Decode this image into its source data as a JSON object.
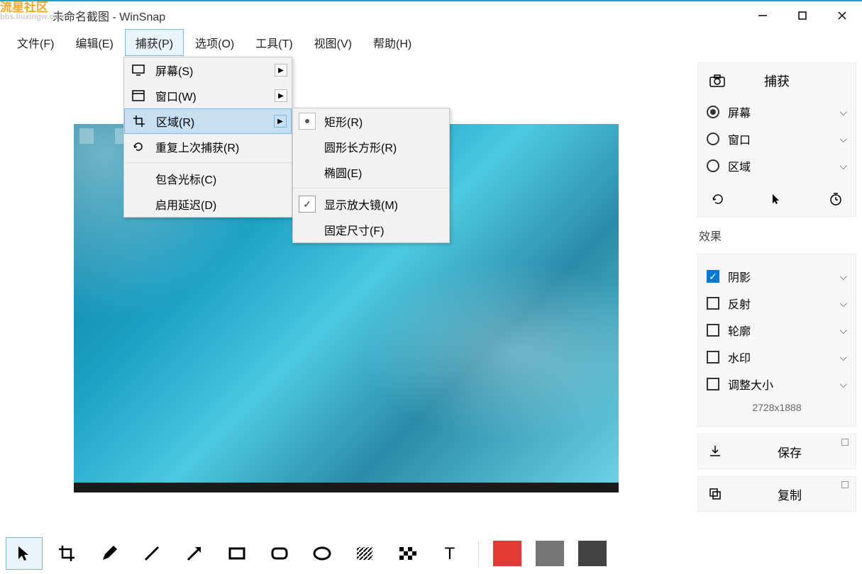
{
  "title": "未命名截图 - WinSnap",
  "watermark": {
    "main": "流星社区",
    "sub": "bbs.liuxingw.com"
  },
  "menubar": [
    "文件(F)",
    "编辑(E)",
    "捕获(P)",
    "选项(O)",
    "工具(T)",
    "视图(V)",
    "帮助(H)"
  ],
  "menubar_open_index": 2,
  "dropdown1": {
    "items": [
      {
        "icon": "monitor",
        "label": "屏幕(S)",
        "submenu": true
      },
      {
        "icon": "window",
        "label": "窗口(W)",
        "submenu": true
      },
      {
        "icon": "crop",
        "label": "区域(R)",
        "submenu": true,
        "highlight": true
      },
      {
        "icon": "undo",
        "label": "重复上次捕获(R)"
      }
    ],
    "extras": [
      "包含光标(C)",
      "启用延迟(D)"
    ]
  },
  "dropdown2": {
    "items": [
      {
        "bullet": true,
        "label": "矩形(R)"
      },
      {
        "label": "圆形长方形(R)"
      },
      {
        "label": "椭圆(E)"
      }
    ],
    "extras": [
      {
        "checked": true,
        "label": "显示放大镜(M)"
      },
      {
        "label": "固定尺寸(F)"
      }
    ]
  },
  "sidebar": {
    "capture": {
      "title": "捕获",
      "options": [
        {
          "label": "屏幕",
          "selected": true
        },
        {
          "label": "窗口",
          "selected": false
        },
        {
          "label": "区域",
          "selected": false
        }
      ]
    },
    "effects": {
      "title": "效果",
      "options": [
        {
          "label": "阴影",
          "checked": true
        },
        {
          "label": "反射",
          "checked": false
        },
        {
          "label": "轮廓",
          "checked": false
        },
        {
          "label": "水印",
          "checked": false
        },
        {
          "label": "调整大小",
          "checked": false
        }
      ],
      "dimensions": "2728x1888"
    },
    "save": "保存",
    "copy": "复制"
  },
  "toolbar": {
    "swatches": [
      "#e53935",
      "#757575",
      "#424242"
    ]
  }
}
